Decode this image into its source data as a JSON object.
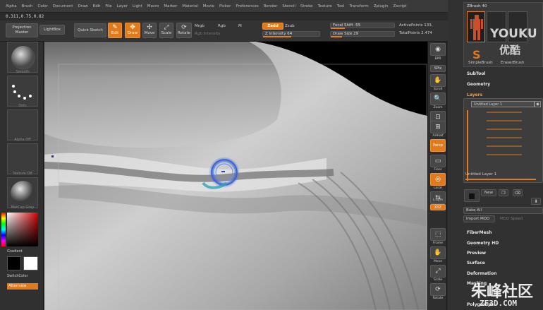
{
  "menubar": {
    "items": [
      "Alpha",
      "Brush",
      "Color",
      "Document",
      "Draw",
      "Edit",
      "File",
      "Layer",
      "Light",
      "Macro",
      "Marker",
      "Material",
      "Movie",
      "Picker",
      "Preferences",
      "Render",
      "Stencil",
      "Stroke",
      "Texture",
      "Tool",
      "Transform",
      "Zplugin",
      "Zscript"
    ]
  },
  "coords": "0.311,0.75,0.82",
  "toolbar": {
    "projection_master": "Projection Master",
    "lightbox": "LightBox",
    "quick_sketch": "Quick Sketch",
    "edit": "Edit",
    "draw": "Draw",
    "move": "Move",
    "scale": "Scale",
    "rotate": "Rotate",
    "mrgb": "Mrgb",
    "rgb": "Rgb",
    "m": "M",
    "rgb_intensity": "Rgb Intensity",
    "zadd": "Zadd",
    "zsub": "Zsub",
    "z_intensity": "Z Intensity 64",
    "focal_shift": "Focal Shift -55",
    "draw_size": "Draw Size 29",
    "active_points": "ActivePoints 133,",
    "total_points": "TotalPoints 2.474"
  },
  "left_shelf": {
    "slots": [
      "Smooth",
      "Dots",
      "Alpha Off",
      "Texture Off",
      "MatCap Gray"
    ],
    "gradient": "Gradient",
    "switch_color": "SwitchColor",
    "alternate": "Alternate"
  },
  "right_shelf": {
    "buttons": [
      "BPR",
      "SPix",
      "Scroll",
      "Zoom",
      "Actual",
      "AAHalf",
      "Persp",
      "Floor",
      "Local",
      "L.Sym",
      "XYZ",
      "Frame",
      "Move",
      "Scale",
      "Rotate"
    ]
  },
  "right_panel": {
    "subdiv": "ZBrush 40",
    "simple_brush": "SimpleBrush",
    "eraser_brush": "EraserBrush",
    "subtool": "SubTool",
    "geometry": "Geometry",
    "layers": "Layers",
    "untitled_layer_1": "Untitled Layer 1",
    "untitled_layer_1_bottom": "Untitled Layer 1",
    "new": "New",
    "bake_all": "Bake All",
    "import_mdd": "Import MDD",
    "mdd_speed": "MDD Speed",
    "fibermesh": "FiberMesh",
    "geometry_hd": "Geometry HD",
    "preview": "Preview",
    "surface": "Surface",
    "deformation": "Deformation",
    "masking": "Masking",
    "polygroups": "Polygroups"
  },
  "watermarks": {
    "youku_en": "YOUKU",
    "youku_cn": "优酷",
    "zf3d_cn": "朱峰社区",
    "zf3d_en": "ZF3D.COM"
  },
  "colors": {
    "accent": "#e07a1a",
    "panel": "#313131"
  }
}
